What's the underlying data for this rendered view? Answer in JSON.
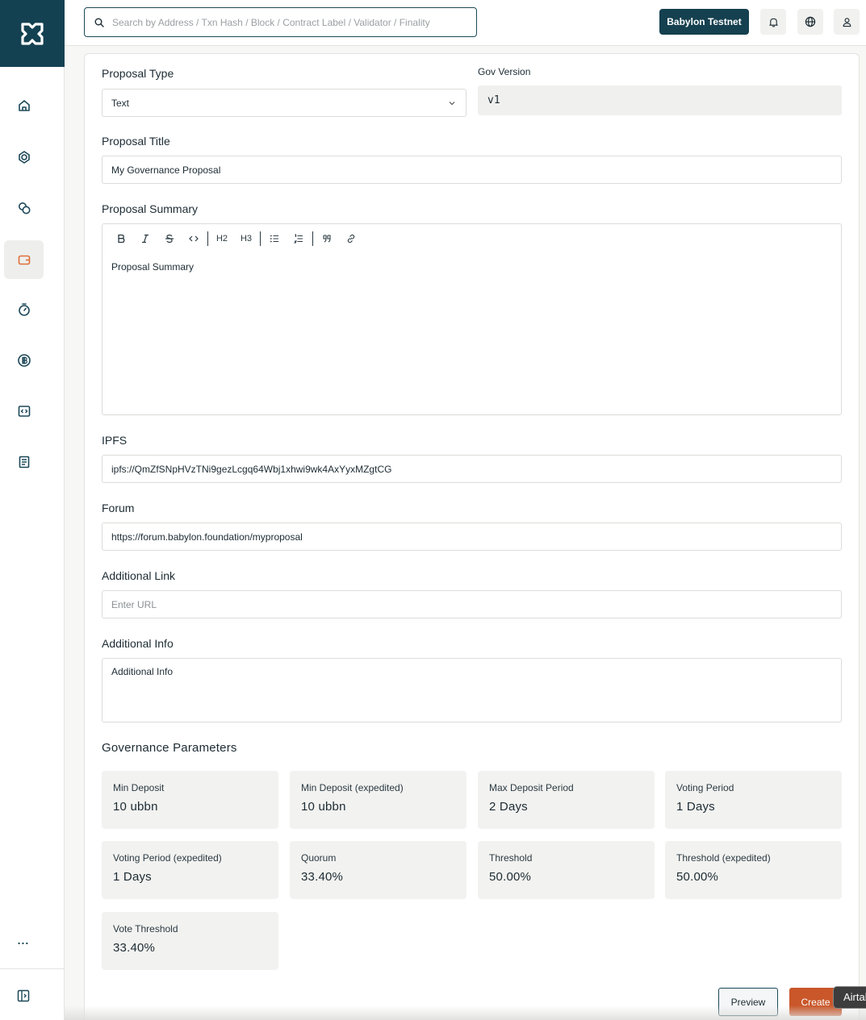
{
  "header": {
    "search_placeholder": "Search by Address / Txn Hash / Block / Contract Label / Validator / Finality",
    "network_label": "Babylon Testnet"
  },
  "sidebar": {
    "items": [
      {
        "icon": "home-icon"
      },
      {
        "icon": "network-icon"
      },
      {
        "icon": "coins-icon"
      },
      {
        "icon": "wallet-icon",
        "active": true
      },
      {
        "icon": "stopwatch-icon"
      },
      {
        "icon": "bitcoin-icon"
      },
      {
        "icon": "code-icon"
      },
      {
        "icon": "document-icon"
      }
    ],
    "more_label": "..."
  },
  "form": {
    "proposal_type_label": "Proposal Type",
    "proposal_type_value": "Text",
    "gov_version_label": "Gov Version",
    "gov_version_value": "v1",
    "title_label": "Proposal Title",
    "title_value": "My Governance Proposal",
    "summary_label": "Proposal Summary",
    "summary_text": "Proposal Summary",
    "toolbar": [
      "bold",
      "italic",
      "strikethrough",
      "code",
      "H2",
      "H3",
      "bullet-list",
      "ordered-list",
      "quote",
      "link"
    ],
    "ipfs_label": "IPFS",
    "ipfs_value": "ipfs://QmZfSNpHVzTNi9gezLcgq64Wbj1xhwi9wk4AxYyxMZgtCG",
    "forum_label": "Forum",
    "forum_value": "https://forum.babylon.foundation/myproposal",
    "additional_link_label": "Additional Link",
    "additional_link_placeholder": "Enter URL",
    "additional_info_label": "Additional Info",
    "additional_info_placeholder": "Additional Info"
  },
  "governance": {
    "title": "Governance Parameters",
    "params": [
      {
        "label": "Min Deposit",
        "value": "10 ubbn"
      },
      {
        "label": "Min Deposit (expedited)",
        "value": "10 ubbn"
      },
      {
        "label": "Max Deposit Period",
        "value": "2 Days"
      },
      {
        "label": "Voting Period",
        "value": "1 Days"
      },
      {
        "label": "Voting Period (expedited)",
        "value": "1 Days"
      },
      {
        "label": "Quorum",
        "value": "33.40%"
      },
      {
        "label": "Threshold",
        "value": "50.00%"
      },
      {
        "label": "Threshold (expedited)",
        "value": "50.00%"
      },
      {
        "label": "Vote Threshold",
        "value": "33.40%"
      }
    ]
  },
  "actions": {
    "preview_label": "Preview",
    "create_label": "Create"
  },
  "overlay": {
    "airtable_label": "Airtable"
  },
  "colors": {
    "brand_dark": "#144152",
    "accent_orange": "#c9572a",
    "active_icon": "#e0703a"
  }
}
